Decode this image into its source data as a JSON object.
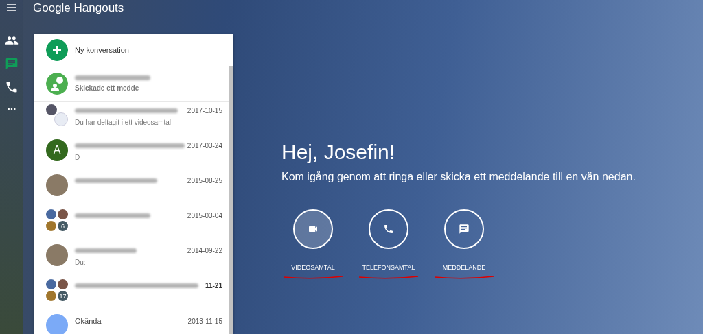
{
  "app_title": "Google Hangouts",
  "rail": [
    {
      "kind": "people",
      "selected": false
    },
    {
      "kind": "chat",
      "selected": true
    },
    {
      "kind": "phone",
      "selected": false
    },
    {
      "kind": "more",
      "selected": false
    }
  ],
  "new_conversation": "Ny konversation",
  "invite": {
    "snippet": "Skickade ett medde"
  },
  "conversations": [
    {
      "kind": "pair",
      "date": "2017-10-15",
      "snippet": "Du har deltagit i ett videosamtal",
      "unread": false
    },
    {
      "kind": "letter",
      "letter": "A",
      "date": "2017-03-24",
      "snippet": "D",
      "unread": false
    },
    {
      "kind": "photo",
      "date": "2015-08-25",
      "unread": false
    },
    {
      "kind": "group",
      "count": "6",
      "date": "2015-03-04",
      "unread": false
    },
    {
      "kind": "photo",
      "date": "2014-09-22",
      "snippet": "Du:",
      "unread": false
    },
    {
      "kind": "group",
      "count": "17",
      "date": "11-21",
      "unread": true
    },
    {
      "kind": "person",
      "name": "Okända",
      "date": "2013-11-15",
      "unread": false
    }
  ],
  "greeting": "Hej, Josefin!",
  "subtitle": "Kom igång genom att ringa eller skicka ett meddelande till en vän nedan.",
  "actions": [
    {
      "kind": "video",
      "label": "VIDEOSAMTAL"
    },
    {
      "kind": "phone",
      "label": "TELEFONSAMTAL"
    },
    {
      "kind": "message",
      "label": "MEDDELANDE"
    }
  ]
}
